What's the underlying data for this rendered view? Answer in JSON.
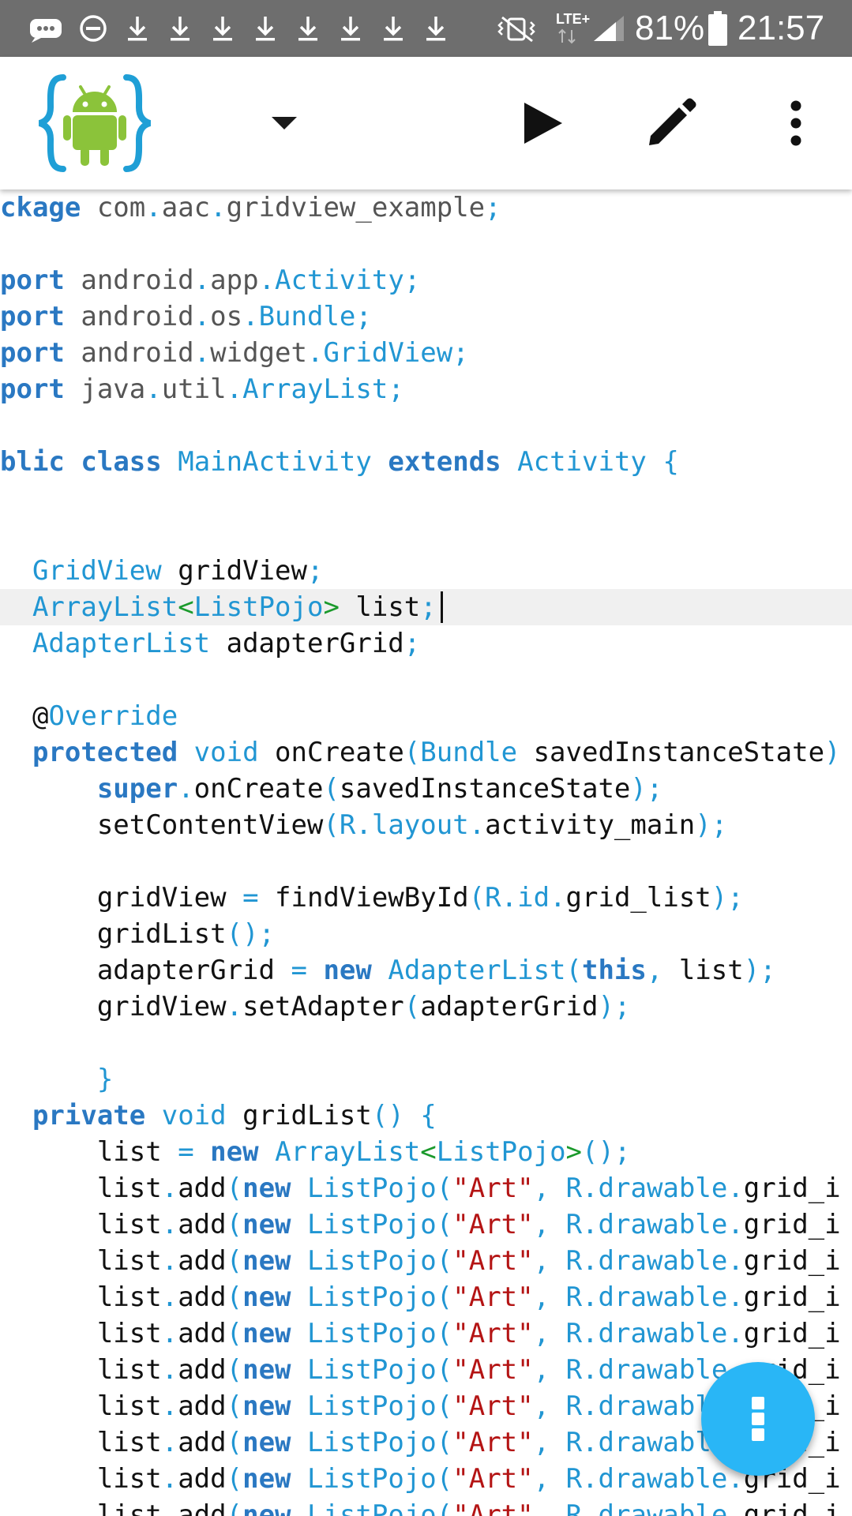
{
  "status_bar": {
    "battery_percent": "81%",
    "time": "21:57",
    "network": "LTE+",
    "download_icon_count": 8
  },
  "toolbar": {
    "app_icon": "android-code-editor-logo",
    "dropdown_icon": "caret-down-icon",
    "run_icon": "play-icon",
    "edit_icon": "pencil-icon",
    "menu_icon": "more-vert-icon"
  },
  "editor": {
    "current_line_index": 11,
    "lines": [
      [
        [
          "ckage",
          "keyword"
        ],
        [
          " com",
          "pkg"
        ],
        [
          ".",
          "punct"
        ],
        [
          "aac",
          "pkg"
        ],
        [
          ".",
          "punct"
        ],
        [
          "gridview_example",
          "pkg"
        ],
        [
          ";",
          "punct"
        ]
      ],
      [],
      [
        [
          "port",
          "keyword"
        ],
        [
          " android",
          "pkg"
        ],
        [
          ".",
          "punct"
        ],
        [
          "app",
          "pkg"
        ],
        [
          ".",
          "punct"
        ],
        [
          "Activity",
          "type"
        ],
        [
          ";",
          "punct"
        ]
      ],
      [
        [
          "port",
          "keyword"
        ],
        [
          " android",
          "pkg"
        ],
        [
          ".",
          "punct"
        ],
        [
          "os",
          "pkg"
        ],
        [
          ".",
          "punct"
        ],
        [
          "Bundle",
          "type"
        ],
        [
          ";",
          "punct"
        ]
      ],
      [
        [
          "port",
          "keyword"
        ],
        [
          " android",
          "pkg"
        ],
        [
          ".",
          "punct"
        ],
        [
          "widget",
          "pkg"
        ],
        [
          ".",
          "punct"
        ],
        [
          "GridView",
          "type"
        ],
        [
          ";",
          "punct"
        ]
      ],
      [
        [
          "port",
          "keyword"
        ],
        [
          " java",
          "pkg"
        ],
        [
          ".",
          "punct"
        ],
        [
          "util",
          "pkg"
        ],
        [
          ".",
          "punct"
        ],
        [
          "ArrayList",
          "type"
        ],
        [
          ";",
          "punct"
        ]
      ],
      [],
      [
        [
          "blic",
          "keyword"
        ],
        [
          " ",
          "plain"
        ],
        [
          "class",
          "keyword"
        ],
        [
          " ",
          "plain"
        ],
        [
          "MainActivity",
          "type"
        ],
        [
          " ",
          "plain"
        ],
        [
          "extends",
          "keyword"
        ],
        [
          " ",
          "plain"
        ],
        [
          "Activity",
          "type"
        ],
        [
          " {",
          "punct"
        ]
      ],
      [],
      [],
      [
        [
          "  ",
          "plain"
        ],
        [
          "GridView",
          "type"
        ],
        [
          " gridView",
          "plain"
        ],
        [
          ";",
          "punct"
        ]
      ],
      [
        [
          "  ",
          "plain"
        ],
        [
          "ArrayList",
          "type"
        ],
        [
          "<",
          "generic"
        ],
        [
          "ListPojo",
          "type"
        ],
        [
          ">",
          "generic"
        ],
        [
          " list",
          "plain"
        ],
        [
          ";",
          "punct"
        ]
      ],
      [
        [
          "  ",
          "plain"
        ],
        [
          "AdapterList",
          "type"
        ],
        [
          " adapterGrid",
          "plain"
        ],
        [
          ";",
          "punct"
        ]
      ],
      [],
      [
        [
          "  ",
          "plain"
        ],
        [
          "@",
          "plain"
        ],
        [
          "Override",
          "type"
        ]
      ],
      [
        [
          "  ",
          "plain"
        ],
        [
          "protected",
          "keyword"
        ],
        [
          " ",
          "plain"
        ],
        [
          "void",
          "type"
        ],
        [
          " onCreate",
          "plain"
        ],
        [
          "(",
          "punct"
        ],
        [
          "Bundle",
          "type"
        ],
        [
          " savedInstanceState",
          "plain"
        ],
        [
          ")",
          "punct"
        ]
      ],
      [
        [
          "      ",
          "plain"
        ],
        [
          "super",
          "keyword"
        ],
        [
          ".",
          "punct"
        ],
        [
          "onCreate",
          "plain"
        ],
        [
          "(",
          "punct"
        ],
        [
          "savedInstanceState",
          "plain"
        ],
        [
          ");",
          "punct"
        ]
      ],
      [
        [
          "      ",
          "plain"
        ],
        [
          "setContentView",
          "plain"
        ],
        [
          "(",
          "punct"
        ],
        [
          "R",
          "type"
        ],
        [
          ".",
          "punct"
        ],
        [
          "layout",
          "type"
        ],
        [
          ".",
          "punct"
        ],
        [
          "activity_main",
          "plain"
        ],
        [
          ");",
          "punct"
        ]
      ],
      [],
      [
        [
          "      ",
          "plain"
        ],
        [
          "gridView ",
          "plain"
        ],
        [
          "=",
          "punct"
        ],
        [
          " findViewById",
          "plain"
        ],
        [
          "(",
          "punct"
        ],
        [
          "R",
          "type"
        ],
        [
          ".",
          "punct"
        ],
        [
          "id",
          "type"
        ],
        [
          ".",
          "punct"
        ],
        [
          "grid_list",
          "plain"
        ],
        [
          ");",
          "punct"
        ]
      ],
      [
        [
          "      ",
          "plain"
        ],
        [
          "gridList",
          "plain"
        ],
        [
          "();",
          "punct"
        ]
      ],
      [
        [
          "      ",
          "plain"
        ],
        [
          "adapterGrid ",
          "plain"
        ],
        [
          "=",
          "punct"
        ],
        [
          " ",
          "plain"
        ],
        [
          "new",
          "keyword"
        ],
        [
          " ",
          "plain"
        ],
        [
          "AdapterList(",
          "type"
        ],
        [
          "this",
          "keyword"
        ],
        [
          ",",
          "punct"
        ],
        [
          " list",
          "plain"
        ],
        [
          ");",
          "punct"
        ]
      ],
      [
        [
          "      ",
          "plain"
        ],
        [
          "gridView",
          "plain"
        ],
        [
          ".",
          "punct"
        ],
        [
          "setAdapter",
          "plain"
        ],
        [
          "(",
          "punct"
        ],
        [
          "adapterGrid",
          "plain"
        ],
        [
          ");",
          "punct"
        ]
      ],
      [],
      [
        [
          "      ",
          "plain"
        ],
        [
          "}",
          "punct"
        ]
      ],
      [
        [
          "  ",
          "plain"
        ],
        [
          "private",
          "keyword"
        ],
        [
          " ",
          "plain"
        ],
        [
          "void",
          "type"
        ],
        [
          " gridList",
          "plain"
        ],
        [
          "()",
          "punct"
        ],
        [
          " {",
          "punct"
        ]
      ],
      [
        [
          "      ",
          "plain"
        ],
        [
          "list ",
          "plain"
        ],
        [
          "=",
          "punct"
        ],
        [
          " ",
          "plain"
        ],
        [
          "new",
          "keyword"
        ],
        [
          " ",
          "plain"
        ],
        [
          "ArrayList",
          "type"
        ],
        [
          "<",
          "generic"
        ],
        [
          "ListPojo",
          "type"
        ],
        [
          ">",
          "generic"
        ],
        [
          "();",
          "punct"
        ]
      ],
      [
        [
          "      ",
          "plain"
        ],
        [
          "list",
          "plain"
        ],
        [
          ".",
          "punct"
        ],
        [
          "add",
          "plain"
        ],
        [
          "(",
          "punct"
        ],
        [
          "new",
          "keyword"
        ],
        [
          " ",
          "plain"
        ],
        [
          "ListPojo(",
          "type"
        ],
        [
          "\"Art\"",
          "string"
        ],
        [
          ",",
          "punct"
        ],
        [
          " ",
          "plain"
        ],
        [
          "R",
          "type"
        ],
        [
          ".",
          "punct"
        ],
        [
          "drawable",
          "type"
        ],
        [
          ".",
          "punct"
        ],
        [
          "grid_i",
          "plain"
        ]
      ],
      [
        [
          "      ",
          "plain"
        ],
        [
          "list",
          "plain"
        ],
        [
          ".",
          "punct"
        ],
        [
          "add",
          "plain"
        ],
        [
          "(",
          "punct"
        ],
        [
          "new",
          "keyword"
        ],
        [
          " ",
          "plain"
        ],
        [
          "ListPojo(",
          "type"
        ],
        [
          "\"Art\"",
          "string"
        ],
        [
          ",",
          "punct"
        ],
        [
          " ",
          "plain"
        ],
        [
          "R",
          "type"
        ],
        [
          ".",
          "punct"
        ],
        [
          "drawable",
          "type"
        ],
        [
          ".",
          "punct"
        ],
        [
          "grid_i",
          "plain"
        ]
      ],
      [
        [
          "      ",
          "plain"
        ],
        [
          "list",
          "plain"
        ],
        [
          ".",
          "punct"
        ],
        [
          "add",
          "plain"
        ],
        [
          "(",
          "punct"
        ],
        [
          "new",
          "keyword"
        ],
        [
          " ",
          "plain"
        ],
        [
          "ListPojo(",
          "type"
        ],
        [
          "\"Art\"",
          "string"
        ],
        [
          ",",
          "punct"
        ],
        [
          " ",
          "plain"
        ],
        [
          "R",
          "type"
        ],
        [
          ".",
          "punct"
        ],
        [
          "drawable",
          "type"
        ],
        [
          ".",
          "punct"
        ],
        [
          "grid_i",
          "plain"
        ]
      ],
      [
        [
          "      ",
          "plain"
        ],
        [
          "list",
          "plain"
        ],
        [
          ".",
          "punct"
        ],
        [
          "add",
          "plain"
        ],
        [
          "(",
          "punct"
        ],
        [
          "new",
          "keyword"
        ],
        [
          " ",
          "plain"
        ],
        [
          "ListPojo(",
          "type"
        ],
        [
          "\"Art\"",
          "string"
        ],
        [
          ",",
          "punct"
        ],
        [
          " ",
          "plain"
        ],
        [
          "R",
          "type"
        ],
        [
          ".",
          "punct"
        ],
        [
          "drawable",
          "type"
        ],
        [
          ".",
          "punct"
        ],
        [
          "grid_i",
          "plain"
        ]
      ],
      [
        [
          "      ",
          "plain"
        ],
        [
          "list",
          "plain"
        ],
        [
          ".",
          "punct"
        ],
        [
          "add",
          "plain"
        ],
        [
          "(",
          "punct"
        ],
        [
          "new",
          "keyword"
        ],
        [
          " ",
          "plain"
        ],
        [
          "ListPojo(",
          "type"
        ],
        [
          "\"Art\"",
          "string"
        ],
        [
          ",",
          "punct"
        ],
        [
          " ",
          "plain"
        ],
        [
          "R",
          "type"
        ],
        [
          ".",
          "punct"
        ],
        [
          "drawable",
          "type"
        ],
        [
          ".",
          "punct"
        ],
        [
          "grid_i",
          "plain"
        ]
      ],
      [
        [
          "      ",
          "plain"
        ],
        [
          "list",
          "plain"
        ],
        [
          ".",
          "punct"
        ],
        [
          "add",
          "plain"
        ],
        [
          "(",
          "punct"
        ],
        [
          "new",
          "keyword"
        ],
        [
          " ",
          "plain"
        ],
        [
          "ListPojo(",
          "type"
        ],
        [
          "\"Art\"",
          "string"
        ],
        [
          ",",
          "punct"
        ],
        [
          " ",
          "plain"
        ],
        [
          "R",
          "type"
        ],
        [
          ".",
          "punct"
        ],
        [
          "drawable",
          "type"
        ],
        [
          ".",
          "punct"
        ],
        [
          "grid_i",
          "plain"
        ]
      ],
      [
        [
          "      ",
          "plain"
        ],
        [
          "list",
          "plain"
        ],
        [
          ".",
          "punct"
        ],
        [
          "add",
          "plain"
        ],
        [
          "(",
          "punct"
        ],
        [
          "new",
          "keyword"
        ],
        [
          " ",
          "plain"
        ],
        [
          "ListPojo(",
          "type"
        ],
        [
          "\"Art\"",
          "string"
        ],
        [
          ",",
          "punct"
        ],
        [
          " ",
          "plain"
        ],
        [
          "R",
          "type"
        ],
        [
          ".",
          "punct"
        ],
        [
          "drawable",
          "type"
        ],
        [
          ".",
          "punct"
        ],
        [
          "grid_i",
          "plain"
        ]
      ],
      [
        [
          "      ",
          "plain"
        ],
        [
          "list",
          "plain"
        ],
        [
          ".",
          "punct"
        ],
        [
          "add",
          "plain"
        ],
        [
          "(",
          "punct"
        ],
        [
          "new",
          "keyword"
        ],
        [
          " ",
          "plain"
        ],
        [
          "ListPojo(",
          "type"
        ],
        [
          "\"Art\"",
          "string"
        ],
        [
          ",",
          "punct"
        ],
        [
          " ",
          "plain"
        ],
        [
          "R",
          "type"
        ],
        [
          ".",
          "punct"
        ],
        [
          "drawable",
          "type"
        ],
        [
          ".",
          "punct"
        ],
        [
          "grid_i",
          "plain"
        ]
      ],
      [
        [
          "      ",
          "plain"
        ],
        [
          "list",
          "plain"
        ],
        [
          ".",
          "punct"
        ],
        [
          "add",
          "plain"
        ],
        [
          "(",
          "punct"
        ],
        [
          "new",
          "keyword"
        ],
        [
          " ",
          "plain"
        ],
        [
          "ListPojo(",
          "type"
        ],
        [
          "\"Art\"",
          "string"
        ],
        [
          ",",
          "punct"
        ],
        [
          " ",
          "plain"
        ],
        [
          "R",
          "type"
        ],
        [
          ".",
          "punct"
        ],
        [
          "drawable",
          "type"
        ],
        [
          ".",
          "punct"
        ],
        [
          "grid_i",
          "plain"
        ]
      ],
      [
        [
          "      ",
          "plain"
        ],
        [
          "list",
          "plain"
        ],
        [
          ".",
          "punct"
        ],
        [
          "add",
          "plain"
        ],
        [
          "(",
          "punct"
        ],
        [
          "new",
          "keyword"
        ],
        [
          " ",
          "plain"
        ],
        [
          "ListPojo(",
          "type"
        ],
        [
          "\"Art\"",
          "string"
        ],
        [
          ",",
          "punct"
        ],
        [
          " ",
          "plain"
        ],
        [
          "R",
          "type"
        ],
        [
          ".",
          "punct"
        ],
        [
          "drawable",
          "type"
        ],
        [
          ".",
          "punct"
        ],
        [
          "grid_i",
          "plain"
        ]
      ]
    ]
  },
  "fab": {
    "icon": "more-vert-icon"
  }
}
